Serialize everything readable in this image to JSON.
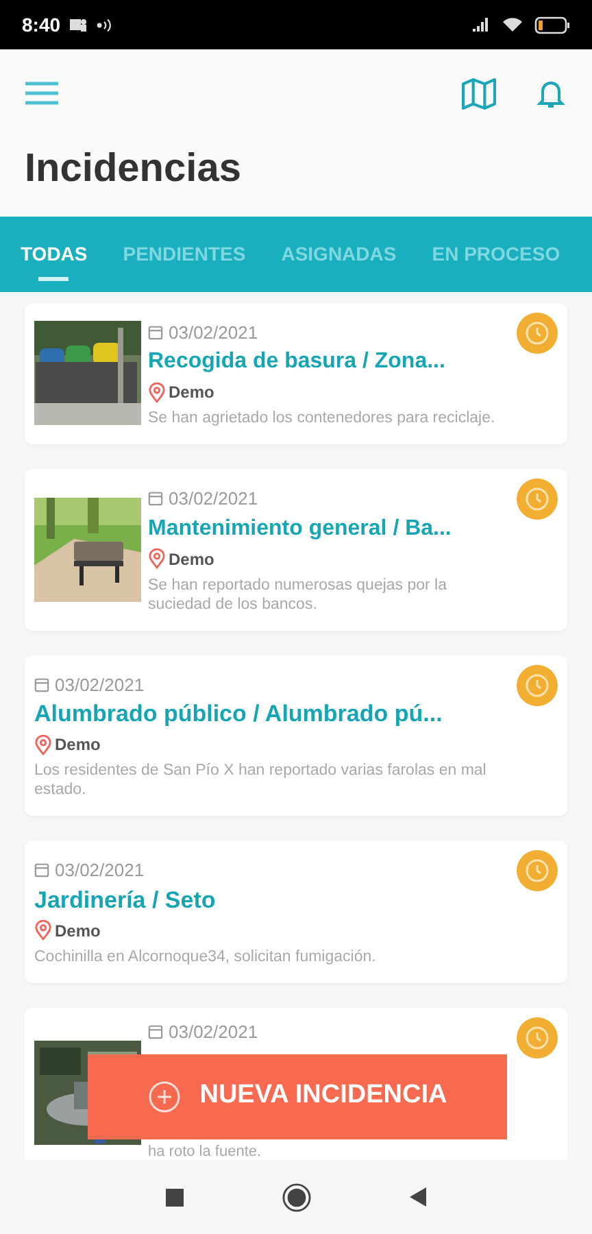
{
  "status_bar": {
    "time": "8:40"
  },
  "header": {
    "title": "Incidencias"
  },
  "tabs": [
    {
      "label": "TODAS",
      "selected": true
    },
    {
      "label": "PENDIENTES",
      "selected": false
    },
    {
      "label": "ASIGNADAS",
      "selected": false
    },
    {
      "label": "EN PROCESO",
      "selected": false
    }
  ],
  "incidents": [
    {
      "date": "03/02/2021",
      "title": "Recogida de basura / Zona...",
      "location": "Demo",
      "description": "Se han agrietado los contenedores para reciclaje."
    },
    {
      "date": "03/02/2021",
      "title": "Mantenimiento general / Ba...",
      "location": "Demo",
      "description": "Se han reportado numerosas quejas por la suciedad de los bancos."
    },
    {
      "date": "03/02/2021",
      "title": "Alumbrado público / Alumbrado pú...",
      "location": "Demo",
      "description": "Los residentes de San Pío X han reportado varias farolas en mal estado."
    },
    {
      "date": "03/02/2021",
      "title": "Jardinería / Seto",
      "location": "Demo",
      "description": "Cochinilla en Alcornoque34, solicitan fumigación."
    },
    {
      "date": "03/02/2021",
      "description": "ha roto la fuente."
    }
  ],
  "fab": {
    "label": "NUEVA INCIDENCIA"
  }
}
